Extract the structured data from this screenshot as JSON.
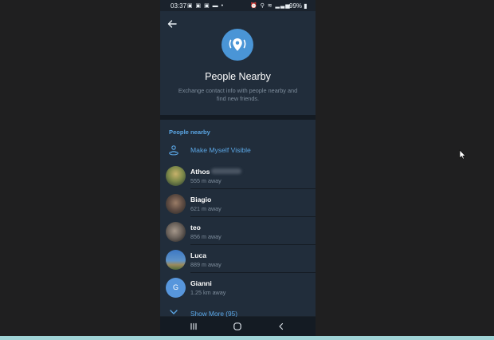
{
  "status_bar": {
    "time": "03:37",
    "left_icons": "▣ ▣ ▣ ▬ •",
    "right_icons": "⏰ ⚲ ≋ ▂▃▅",
    "battery": "99% ▮"
  },
  "header": {
    "back_icon": "arrow-left-icon",
    "title": "People Nearby",
    "subtitle": "Exchange contact info with people nearby and find new friends.",
    "badge_icon": "location-pin-icon",
    "badge_color": "#4a95d6"
  },
  "list": {
    "section_title": "People nearby",
    "make_visible_label": "Make Myself Visible",
    "people": [
      {
        "name": "Athos",
        "distance": "555 m away",
        "avatar": "photo"
      },
      {
        "name": "Biagio",
        "distance": "621 m away",
        "avatar": "photo"
      },
      {
        "name": "teo",
        "distance": "856 m away",
        "avatar": "photo"
      },
      {
        "name": "Luca",
        "distance": "889 m away",
        "avatar": "photo"
      },
      {
        "name": "Gianni",
        "distance": "1.25 km away",
        "avatar": "G"
      }
    ],
    "show_more_label": "Show More (95)"
  },
  "nav_bar": {
    "recents_icon": "recents-icon",
    "home_icon": "home-icon",
    "back_icon": "back-chevron-icon"
  },
  "colors": {
    "accent": "#5ba7e6",
    "background": "#212d3b",
    "avatar_letter_bg": "#5796dc"
  }
}
